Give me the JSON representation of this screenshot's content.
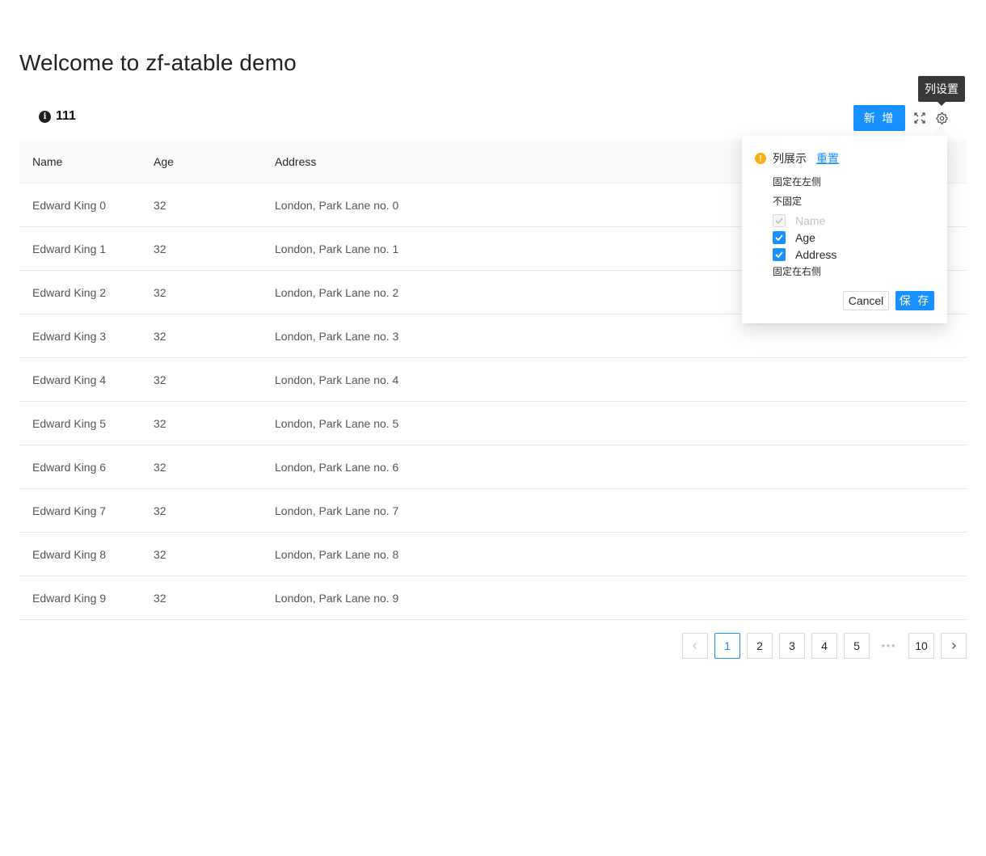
{
  "page": {
    "title": "Welcome to zf-atable demo"
  },
  "toolbar": {
    "info_count": "111",
    "add_label": "新 增",
    "tooltip": "列设置",
    "icons": {
      "info": "info-circle-icon",
      "fullscreen": "fullscreen-icon",
      "settings": "setting-icon"
    }
  },
  "table": {
    "columns": [
      "Name",
      "Age",
      "Address"
    ],
    "rows": [
      {
        "name": "Edward King 0",
        "age": "32",
        "address": "London, Park Lane no. 0"
      },
      {
        "name": "Edward King 1",
        "age": "32",
        "address": "London, Park Lane no. 1"
      },
      {
        "name": "Edward King 2",
        "age": "32",
        "address": "London, Park Lane no. 2"
      },
      {
        "name": "Edward King 3",
        "age": "32",
        "address": "London, Park Lane no. 3"
      },
      {
        "name": "Edward King 4",
        "age": "32",
        "address": "London, Park Lane no. 4"
      },
      {
        "name": "Edward King 5",
        "age": "32",
        "address": "London, Park Lane no. 5"
      },
      {
        "name": "Edward King 6",
        "age": "32",
        "address": "London, Park Lane no. 6"
      },
      {
        "name": "Edward King 7",
        "age": "32",
        "address": "London, Park Lane no. 7"
      },
      {
        "name": "Edward King 8",
        "age": "32",
        "address": "London, Park Lane no. 8"
      },
      {
        "name": "Edward King 9",
        "age": "32",
        "address": "London, Park Lane no. 9"
      }
    ]
  },
  "pagination": {
    "pages": [
      "1",
      "2",
      "3",
      "4",
      "5"
    ],
    "ellipsis": "•••",
    "last": "10",
    "current": "1",
    "prev": "‹",
    "next": "›"
  },
  "column_settings": {
    "title": "列展示",
    "reset": "重置",
    "fixed_left": "固定在左侧",
    "not_fixed": "不固定",
    "fixed_right": "固定在右侧",
    "items": [
      {
        "label": "Name",
        "checked": true,
        "disabled": true
      },
      {
        "label": "Age",
        "checked": true,
        "disabled": false
      },
      {
        "label": "Address",
        "checked": true,
        "disabled": false
      }
    ],
    "cancel": "Cancel",
    "save": "保 存"
  },
  "colors": {
    "primary": "#1890ff",
    "warning": "#faad14",
    "header_bg": "#fafafa"
  }
}
